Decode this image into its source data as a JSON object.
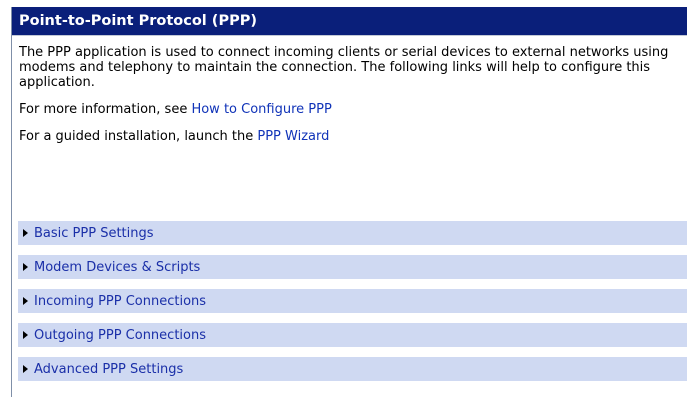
{
  "header": {
    "title": "Point-to-Point Protocol (PPP)"
  },
  "content": {
    "intro": "The PPP application is used to connect incoming clients or serial devices to external networks using modems and telephony to maintain the connection. The following links will help to configure this application.",
    "more_info_prefix": "For more information, see ",
    "more_info_link": "How to Configure PPP",
    "guided_prefix": "For a guided installation, launch the ",
    "guided_link": "PPP Wizard"
  },
  "sections": [
    {
      "label": "Basic PPP Settings"
    },
    {
      "label": "Modem Devices & Scripts"
    },
    {
      "label": "Incoming PPP Connections"
    },
    {
      "label": "Outgoing PPP Connections"
    },
    {
      "label": "Advanced PPP Settings"
    }
  ],
  "colors": {
    "title_bar": "#0a1f7a",
    "section_bg": "#cfd9f2",
    "link": "#1033b8"
  }
}
